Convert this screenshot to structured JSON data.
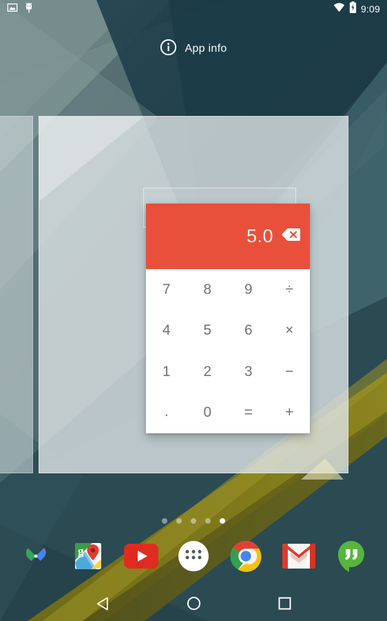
{
  "status_bar": {
    "left_icons": [
      {
        "name": "screenshot-icon",
        "glyph": "image"
      },
      {
        "name": "usb-debug-icon",
        "glyph": "android-debug"
      }
    ],
    "right_icons": [
      {
        "name": "wifi-icon",
        "glyph": "wifi"
      },
      {
        "name": "battery-charging-icon",
        "glyph": "battery-bolt"
      }
    ],
    "time": "9:09"
  },
  "drop_targets": {
    "app_info": {
      "label": "App info",
      "icon": "info-circle-icon"
    }
  },
  "calculator_widget": {
    "display_value": "5.0",
    "clear_icon": "backspace-icon",
    "accent_color": "#e8503c",
    "keypad_color": "#ffffff",
    "keys": [
      {
        "label": "7",
        "type": "digit"
      },
      {
        "label": "8",
        "type": "digit"
      },
      {
        "label": "9",
        "type": "digit"
      },
      {
        "label": "÷",
        "type": "operator"
      },
      {
        "label": "4",
        "type": "digit"
      },
      {
        "label": "5",
        "type": "digit"
      },
      {
        "label": "6",
        "type": "digit"
      },
      {
        "label": "×",
        "type": "operator"
      },
      {
        "label": "1",
        "type": "digit"
      },
      {
        "label": "2",
        "type": "digit"
      },
      {
        "label": "3",
        "type": "digit"
      },
      {
        "label": "−",
        "type": "operator"
      },
      {
        "label": ".",
        "type": "decimal"
      },
      {
        "label": "0",
        "type": "digit"
      },
      {
        "label": "=",
        "type": "equals"
      },
      {
        "label": "+",
        "type": "operator"
      }
    ]
  },
  "page_indicator": {
    "total": 5,
    "active_index": 4
  },
  "dock": {
    "items": [
      {
        "name": "google-photos",
        "icon": "photos-pinwheel-icon"
      },
      {
        "name": "google-maps",
        "icon": "maps-pin-icon"
      },
      {
        "name": "youtube",
        "icon": "youtube-play-icon"
      },
      {
        "name": "all-apps",
        "icon": "app-drawer-icon"
      },
      {
        "name": "chrome",
        "icon": "chrome-icon"
      },
      {
        "name": "gmail",
        "icon": "gmail-envelope-icon"
      },
      {
        "name": "hangouts",
        "icon": "hangouts-quote-icon"
      }
    ]
  },
  "nav_bar": {
    "buttons": [
      {
        "name": "back",
        "icon": "back-triangle-icon"
      },
      {
        "name": "home",
        "icon": "home-circle-icon"
      },
      {
        "name": "recents",
        "icon": "recents-square-icon"
      }
    ]
  },
  "wallpaper": {
    "base_color": "#2c4950",
    "facet_colors": [
      "#1d3c47",
      "#385b63",
      "#4a686c",
      "#6e8486",
      "#8a9b9a"
    ],
    "ribbon_color": "#7d7518"
  }
}
